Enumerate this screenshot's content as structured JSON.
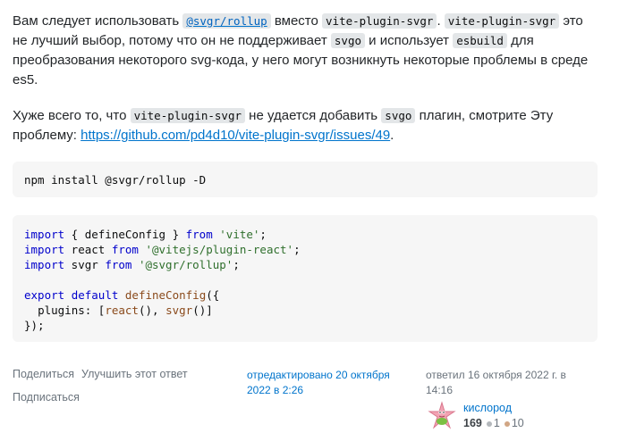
{
  "para1": {
    "t1": "Вам следует использовать ",
    "c1": "@svgr/rollup",
    "t2": " вместо ",
    "c2": "vite-plugin-svgr",
    "t3": ". ",
    "c3": "vite-plugin-svgr",
    "t4": " это не лучший выбор, потому что он не поддерживает ",
    "c4": "svgo",
    "t5": " и использует ",
    "c5": "esbuild",
    "t6": " для преобразования некоторого svg-кода, у него могут возникнуть некоторые проблемы в среде es5."
  },
  "para2": {
    "t1": "Хуже всего то, что ",
    "c1": "vite-plugin-svgr",
    "t2": " не удается добавить ",
    "c2": "svgo",
    "t3": " плагин, смотрите Эту проблему: ",
    "link": "https://github.com/pd4d10/vite-plugin-svgr/issues/49",
    "t4": "."
  },
  "code1": {
    "line1": "npm install @svgr/rollup -D"
  },
  "code2": {
    "l1_kw1": "import",
    "l1_mid": " { defineConfig } ",
    "l1_kw2": "from",
    "l1_str": "'vite'",
    "l2_kw1": "import",
    "l2_mid": " react ",
    "l2_kw2": "from",
    "l2_str": "'@vitejs/plugin-react'",
    "l3_kw1": "import",
    "l3_mid": " svgr ",
    "l3_kw2": "from",
    "l3_str": "'@svgr/rollup'",
    "l5_kw1": "export",
    "l5_kw2": "default",
    "l5_fn": "defineConfig",
    "l6_prop": "plugins",
    "l6_fn1": "react",
    "l6_fn2": "svgr",
    "l7": "});"
  },
  "menu": {
    "share": "Поделиться",
    "improve": "Улучшить этот ответ",
    "follow": "Подписаться"
  },
  "edited": {
    "text": "отредактировано 20 октября 2022 в 2:26"
  },
  "answered": {
    "text": "ответил 16 октября 2022 г. в 14:16"
  },
  "user": {
    "name": "кислород",
    "reputation": "169",
    "silver": "1",
    "bronze": "10"
  },
  "colors": {
    "link": "#0074cc",
    "code_bg": "#f6f6f6",
    "silver": "#b4b8bc",
    "bronze": "#d1a684"
  }
}
